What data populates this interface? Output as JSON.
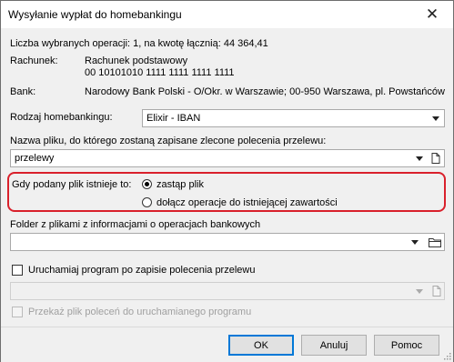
{
  "window": {
    "title": "Wysyłanie wypłat do homebankingu",
    "close_glyph": "✕"
  },
  "summary": {
    "label": "Liczba wybranych operacji:",
    "count": "1",
    "amount_label": "na kwotę łącznią:",
    "amount": "44 364,41"
  },
  "account": {
    "label": "Rachunek:",
    "name": "Rachunek podstawowy",
    "number": "00 10101010 1111 1111 1111 1111"
  },
  "bank": {
    "label": "Bank:",
    "value": "Narodowy Bank Polski  - O/Okr. w Warszawie; 00-950 Warszawa, pl. Powstańców"
  },
  "homebanking_type": {
    "label": "Rodzaj homebankingu:",
    "value": "Elixir - IBAN"
  },
  "file_name": {
    "label": "Nazwa pliku, do którego zostaną zapisane zlecone polecenia przelewu:",
    "value": "przelewy",
    "icon": "document-icon"
  },
  "if_exists": {
    "label": "Gdy podany plik istnieje to:",
    "options": [
      {
        "label": "zastąp plik",
        "selected": true
      },
      {
        "label": "dołącz operacje do istniejącej zawartości",
        "selected": false
      }
    ],
    "highlight_color": "#d9202b"
  },
  "folder": {
    "label": "Folder z plikami z informacjami o operacjach bankowych",
    "value": "",
    "icon": "folder-icon"
  },
  "run_program": {
    "label": "Uruchamiaj program po zapisie polecenia przelewu",
    "checked": false,
    "value": ""
  },
  "pass_file": {
    "label": "Przekaż plik poleceń do uruchamianego programu",
    "checked": false,
    "enabled": false
  },
  "buttons": {
    "ok": "OK",
    "cancel": "Anuluj",
    "help": "Pomoc"
  },
  "colors": {
    "accent": "#0078d7",
    "background": "#f0f0f0"
  }
}
